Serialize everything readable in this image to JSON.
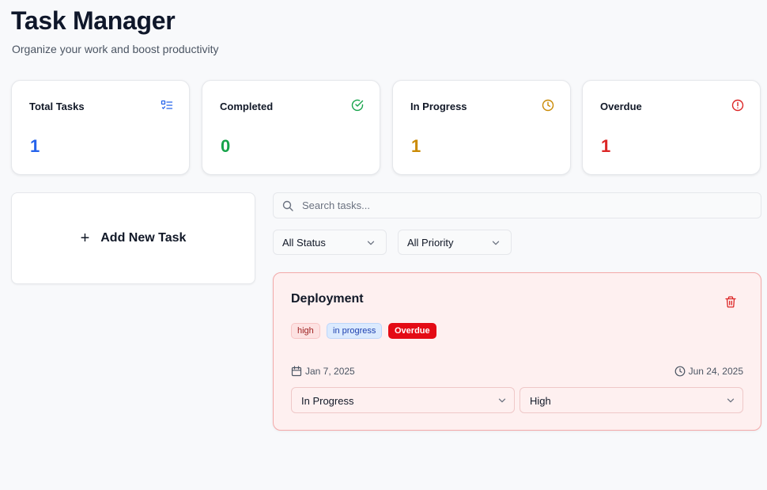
{
  "header": {
    "title": "Task Manager",
    "subtitle": "Organize your work and boost productivity"
  },
  "stats": [
    {
      "label": "Total Tasks",
      "value": "1",
      "icon": "list-check-icon",
      "color": "#2563eb"
    },
    {
      "label": "Completed",
      "value": "0",
      "icon": "check-circle-icon",
      "color": "#16a34a"
    },
    {
      "label": "In Progress",
      "value": "1",
      "icon": "clock-icon",
      "color": "#ca8a04"
    },
    {
      "label": "Overdue",
      "value": "1",
      "icon": "alert-circle-icon",
      "color": "#dc2626"
    }
  ],
  "add_task": {
    "plus": "+",
    "label": "Add New Task"
  },
  "search": {
    "placeholder": "Search tasks...",
    "value": ""
  },
  "filters": {
    "status": "All Status",
    "priority": "All Priority"
  },
  "task": {
    "title": "Deployment",
    "badges": {
      "priority": "high",
      "status": "in progress",
      "overdue": "Overdue"
    },
    "start_date": "Jan 7, 2025",
    "due_date": "Jun 24, 2025",
    "status_select": "In Progress",
    "priority_select": "High"
  }
}
